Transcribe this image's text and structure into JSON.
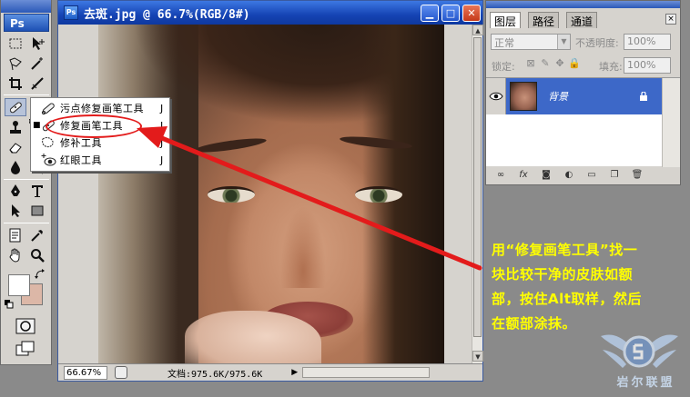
{
  "app": {
    "logo": "Ps"
  },
  "document": {
    "title": "去斑.jpg @ 66.7%(RGB/8#)",
    "zoom": "66.67%",
    "doc_info": "文档:975.6K/975.6K"
  },
  "flyout": {
    "items": [
      {
        "label": "污点修复画笔工具",
        "shortcut": "J",
        "icon": "spot-healing-brush-icon",
        "selected": false
      },
      {
        "label": "修复画笔工具",
        "shortcut": "J",
        "icon": "healing-brush-icon",
        "selected": true
      },
      {
        "label": "修补工具",
        "shortcut": "J",
        "icon": "patch-icon",
        "selected": false
      },
      {
        "label": "红眼工具",
        "shortcut": "J",
        "icon": "red-eye-icon",
        "selected": false
      }
    ]
  },
  "layers_panel": {
    "tabs": [
      "图层",
      "路径",
      "通道"
    ],
    "close_symbol": "×",
    "blend_mode": "正常",
    "opacity_label": "不透明度:",
    "opacity_value": "100%",
    "lock_label": "锁定:",
    "fill_label": "填充:",
    "fill_value": "100%",
    "layer": {
      "name": "背景"
    }
  },
  "annotation": {
    "lines": [
      "用“修复画笔工具”找一",
      "块比较干净的皮肤如额",
      "部，按住Alt取样，然后",
      "在额部涂抹。"
    ]
  },
  "watermark": {
    "text": "岩尔联盟"
  },
  "colors": {
    "foreground": "#ffffff",
    "background": "#dcb7a7",
    "annotation": "#ffff00",
    "arrow": "#e31b1b",
    "selected_layer": "#3d68c8"
  }
}
